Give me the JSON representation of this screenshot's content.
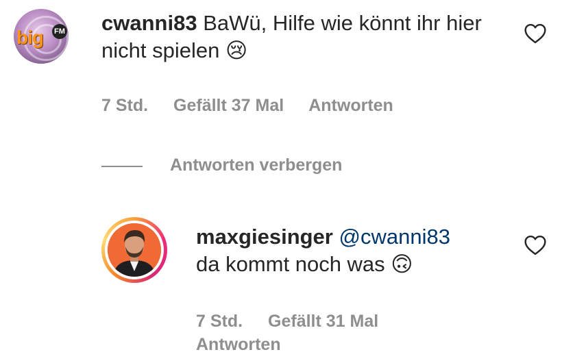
{
  "comment": {
    "username": "cwanni83",
    "text": "BaWü, Hilfe wie könnt ihr hier nicht spielen",
    "emoji": "😢",
    "time": "7 Std.",
    "likes": "Gefällt 37 Mal",
    "reply": "Antworten",
    "avatar_logo": "big",
    "avatar_logo_badge": "FM"
  },
  "hide_replies": "Antworten verbergen",
  "reply": {
    "username": "maxgiesinger",
    "mention": "@cwanni83",
    "text": "da kommt noch was",
    "emoji": "🙃",
    "time": "7 Std.",
    "likes": "Gefällt 31 Mal",
    "reply": "Antworten"
  },
  "icons": {
    "like": "heart-icon",
    "accent_ring": [
      "#f58529",
      "#ee2a7b",
      "#feda75"
    ]
  }
}
